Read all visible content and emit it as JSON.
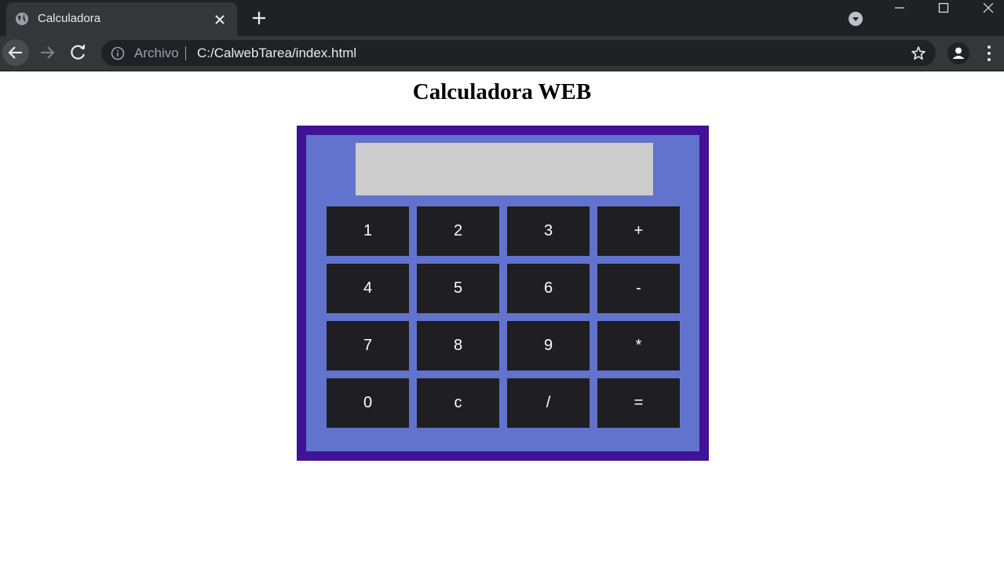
{
  "browser": {
    "tab": {
      "title": "Calculadora"
    },
    "address_bar": {
      "scheme_label": "Archivo",
      "url": "C:/CalwebTarea/index.html"
    }
  },
  "page": {
    "title": "Calculadora WEB",
    "display_value": "",
    "keys": [
      {
        "label": "1"
      },
      {
        "label": "2"
      },
      {
        "label": "3"
      },
      {
        "label": "+"
      },
      {
        "label": "4"
      },
      {
        "label": "5"
      },
      {
        "label": "6"
      },
      {
        "label": "-"
      },
      {
        "label": "7"
      },
      {
        "label": "8"
      },
      {
        "label": "9"
      },
      {
        "label": "*"
      },
      {
        "label": "0"
      },
      {
        "label": "c"
      },
      {
        "label": "/"
      },
      {
        "label": "="
      }
    ]
  },
  "colors": {
    "calc_border": "#3f1298",
    "calc_body": "#6173cc",
    "display": "#cccccc",
    "key_bg": "#1f1e22",
    "key_text": "#ffffff"
  }
}
